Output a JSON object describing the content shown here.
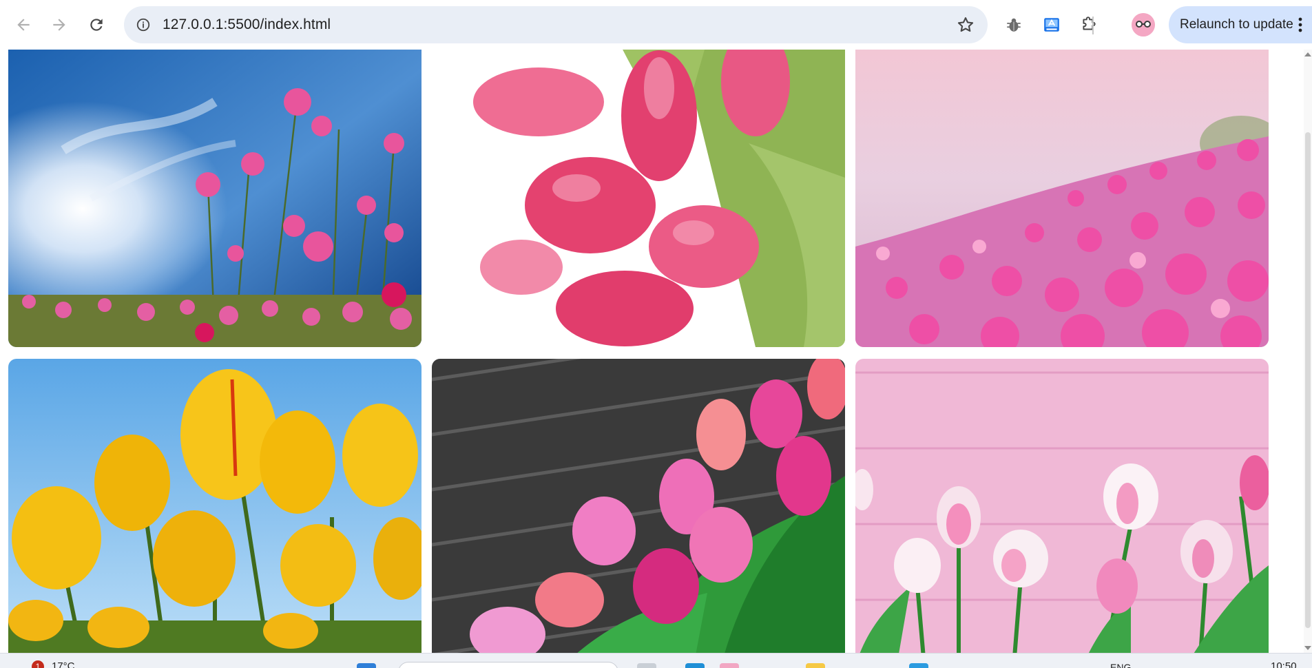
{
  "browser": {
    "url": "127.0.0.1:5500/index.html",
    "relaunch_label": "Relaunch to update",
    "icons": {
      "back": "arrow-left-icon",
      "forward": "arrow-right-icon",
      "reload": "reload-icon",
      "site_info": "info-icon",
      "bookmark": "star-icon",
      "extension_1": "bug-icon",
      "extension_2": "translate-icon",
      "extensions": "puzzle-icon",
      "profile": "avatar",
      "menu": "kebab-menu-icon"
    },
    "accent": "#d3e3fd",
    "omnibox_bg": "#e9eef6"
  },
  "gallery": {
    "tiles": [
      {
        "subject": "pink cosmos flowers against blue sky",
        "palette": [
          "#1b64b6",
          "#e94f9e"
        ]
      },
      {
        "subject": "pink tulip bouquet on white",
        "palette": [
          "#ffffff",
          "#e8497a"
        ]
      },
      {
        "subject": "pink cosmos field at sunset",
        "palette": [
          "#f4c9d6",
          "#ec4fa8"
        ]
      },
      {
        "subject": "yellow tulips against sky",
        "palette": [
          "#6fb3ea",
          "#f5c10e"
        ]
      },
      {
        "subject": "pink tulips on dark wood",
        "palette": [
          "#3b3b3b",
          "#e54d97"
        ]
      },
      {
        "subject": "white-pink tulips on pink wood",
        "palette": [
          "#f0b8d6",
          "#f7f0f3"
        ]
      }
    ]
  },
  "taskbar": {
    "notification_count": "1",
    "temperature": "17°C",
    "language": "ENG",
    "time": "10:50"
  }
}
